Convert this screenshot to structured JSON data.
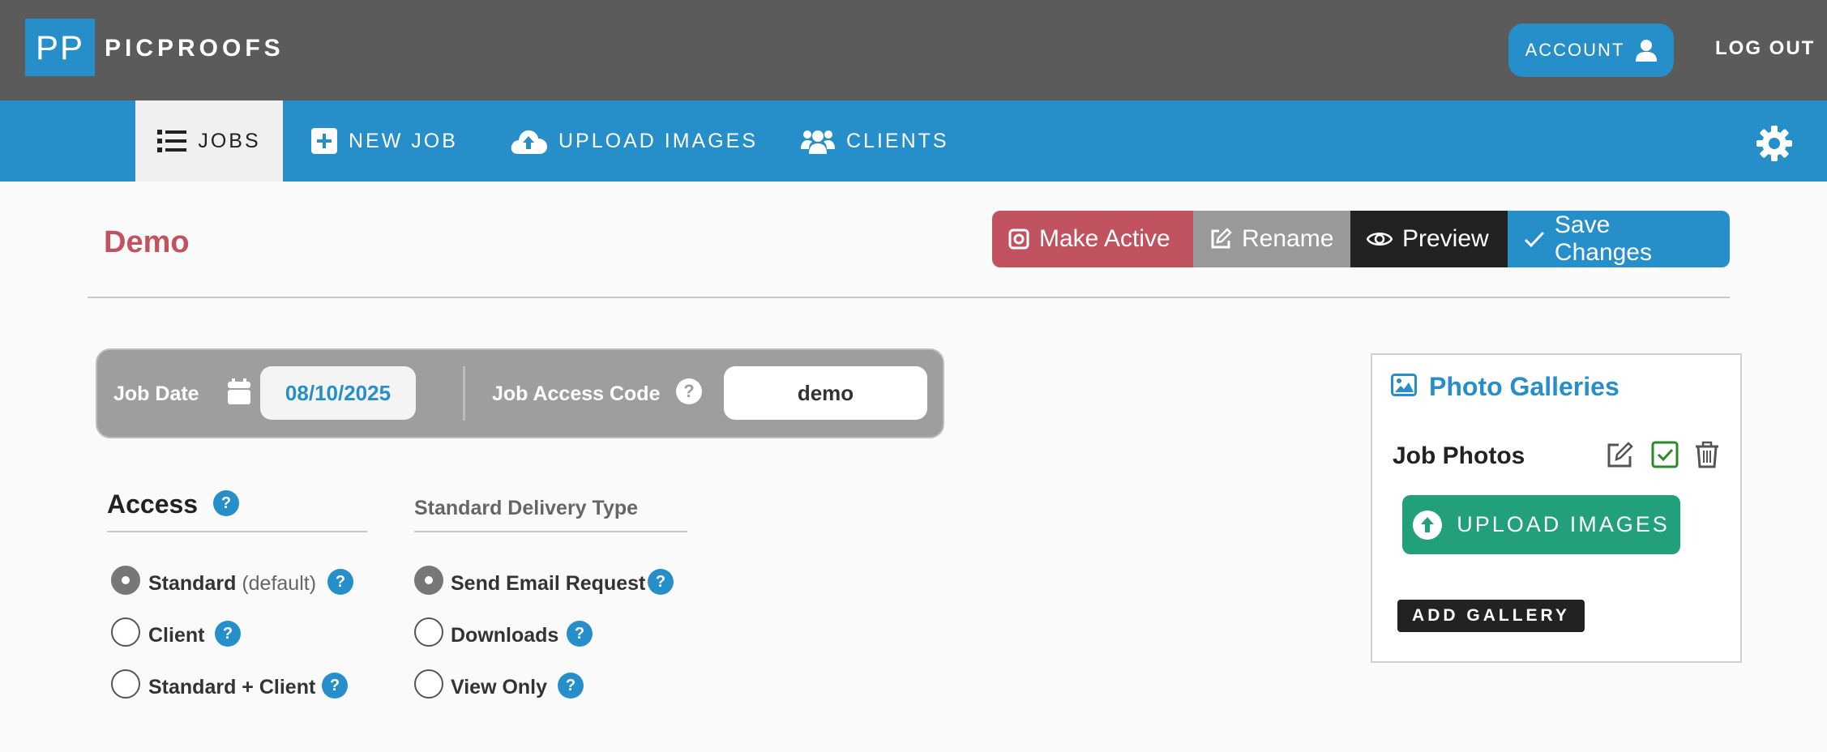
{
  "header": {
    "logo_mark": "PP",
    "logo_text": "PICPROOFS",
    "account_label": "ACCOUNT",
    "logout_label": "LOG OUT"
  },
  "nav": {
    "items": [
      {
        "label": "JOBS",
        "icon": "list-icon",
        "active": true
      },
      {
        "label": "NEW JOB",
        "icon": "plus-square-icon"
      },
      {
        "label": "UPLOAD IMAGES",
        "icon": "cloud-upload-icon"
      },
      {
        "label": "CLIENTS",
        "icon": "users-icon"
      }
    ],
    "settings_icon": "gear-icon"
  },
  "job": {
    "title": "Demo",
    "buttons": {
      "make_active": "Make Active",
      "rename": "Rename",
      "preview": "Preview",
      "save": "Save Changes"
    },
    "date_label": "Job Date",
    "date_value": "08/10/2025",
    "code_label": "Job Access Code",
    "code_help": "?",
    "code_value": "demo"
  },
  "access": {
    "title": "Access",
    "help": "?",
    "options": [
      {
        "label": "Standard",
        "note": "(default)",
        "checked": true
      },
      {
        "label": "Client",
        "checked": false
      },
      {
        "label": "Standard + Client",
        "checked": false
      }
    ]
  },
  "delivery": {
    "title": "Standard Delivery Type",
    "options": [
      {
        "label": "Send Email Request",
        "checked": true
      },
      {
        "label": "Downloads",
        "checked": false
      },
      {
        "label": "View Only",
        "checked": false
      }
    ]
  },
  "galleries": {
    "title": "Photo Galleries",
    "items": [
      {
        "name": "Job Photos",
        "upload_label": "UPLOAD IMAGES"
      }
    ],
    "add_label": "ADD GALLERY"
  },
  "colors": {
    "brand_blue": "#268ec9",
    "topbar_gray": "#5b5b5b",
    "danger_red": "#c1525f",
    "upload_green": "#22a07b",
    "check_green": "#2a8a2a"
  }
}
